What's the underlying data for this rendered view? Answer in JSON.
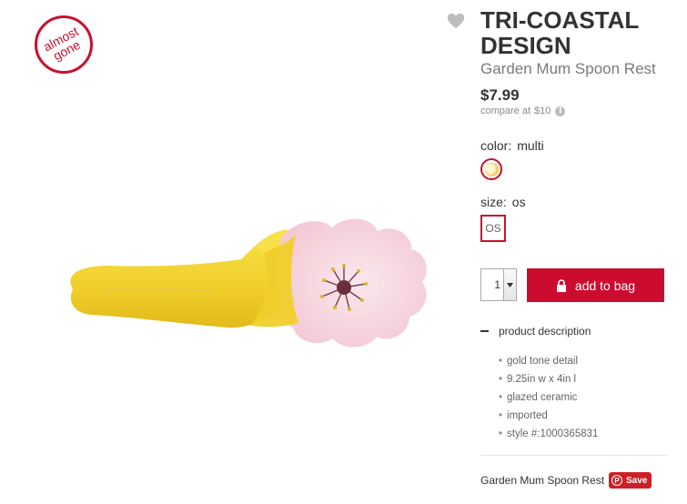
{
  "badge": {
    "text": "almost gone"
  },
  "product": {
    "brand": "TRI-COASTAL DESIGN",
    "name": "Garden Mum Spoon Rest",
    "price": "$7.99",
    "compare_label": "compare at",
    "compare_price": "$10"
  },
  "options": {
    "color_label": "color:",
    "color_value": "multi",
    "size_label": "size:",
    "size_value": "os",
    "size_option": "OS"
  },
  "cart": {
    "quantity": "1",
    "add_label": "add to bag"
  },
  "description": {
    "heading": "product description",
    "items": [
      "gold tone detail",
      "9.25in w x 4in l",
      "glazed ceramic",
      "imported",
      "style #:1000365831"
    ]
  },
  "footer": {
    "name": "Garden Mum Spoon Rest",
    "pin_label": "Save"
  },
  "colors": {
    "accent": "#cc0c2f",
    "badge": "#c8102e",
    "pinterest": "#cb2027",
    "spoon_yellow": "#f2d22e",
    "spoon_pink": "#f6d3dc"
  },
  "icons": {
    "favorite": "heart-icon",
    "info": "info-icon",
    "bag": "lock-bag-icon",
    "pin": "pinterest-icon"
  }
}
